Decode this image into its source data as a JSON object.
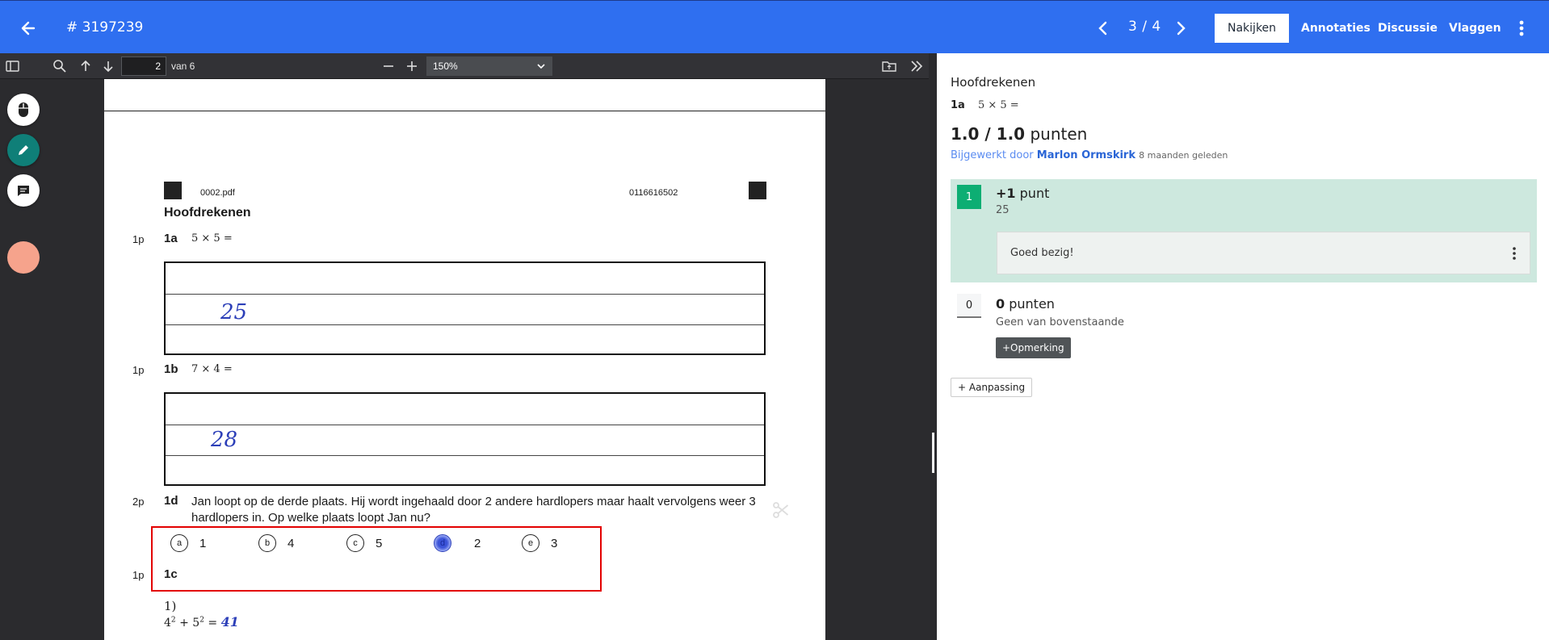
{
  "header": {
    "title": "# 3197239",
    "pager": "3 / 4",
    "tabs": [
      "Nakijken",
      "Annotaties",
      "Discussie",
      "Vlaggen"
    ]
  },
  "viewer": {
    "page_value": "2",
    "page_of": "van 6",
    "zoom": "150%"
  },
  "document": {
    "file_name": "0002.pdf",
    "code": "0116616502",
    "section": "Hoofdrekenen",
    "q1a": {
      "points": "1p",
      "num": "1a",
      "text": "5 × 5 =",
      "answer": "25"
    },
    "q1b": {
      "points": "1p",
      "num": "1b",
      "text": "7 × 4 =",
      "answer": "28"
    },
    "q1d": {
      "points": "2p",
      "num": "1d",
      "text": "Jan loopt op de derde plaats. Hij wordt ingehaald door 2 andere hardlopers maar haalt vervolgens weer 3 hardlopers in. Op welke plaats loopt Jan nu?"
    },
    "choices": [
      {
        "letter": "a",
        "value": "1"
      },
      {
        "letter": "b",
        "value": "4"
      },
      {
        "letter": "c",
        "value": "5"
      },
      {
        "letter": "d",
        "value": "2"
      },
      {
        "letter": "e",
        "value": "3"
      }
    ],
    "q1c": {
      "points": "1p",
      "num": "1c",
      "sub": "1)",
      "answer": "41"
    }
  },
  "panel": {
    "title": "Hoofdrekenen",
    "q_num": "1a",
    "q_math": "5 × 5 =",
    "score": "1.0 / 1.0",
    "score_unit": "punten",
    "updated_prefix": "Bijgewerkt door",
    "updated_by": "Marlon Ormskirk",
    "updated_ago": "8 maanden geleden",
    "crit1": {
      "badge": "1",
      "points": "+1",
      "unit": "punt",
      "desc": "25",
      "comment": "Goed bezig!"
    },
    "crit0": {
      "badge": "0",
      "points": "0",
      "unit": "punten",
      "desc": "Geen van bovenstaande"
    },
    "add_comment": "+Opmerking",
    "add_adjust": "+ Aanpassing"
  },
  "colors": {
    "appbar": "#2f6ff0",
    "selected": "#cde8de",
    "badge_green": "#0dae73",
    "highlight": "#e30000"
  }
}
